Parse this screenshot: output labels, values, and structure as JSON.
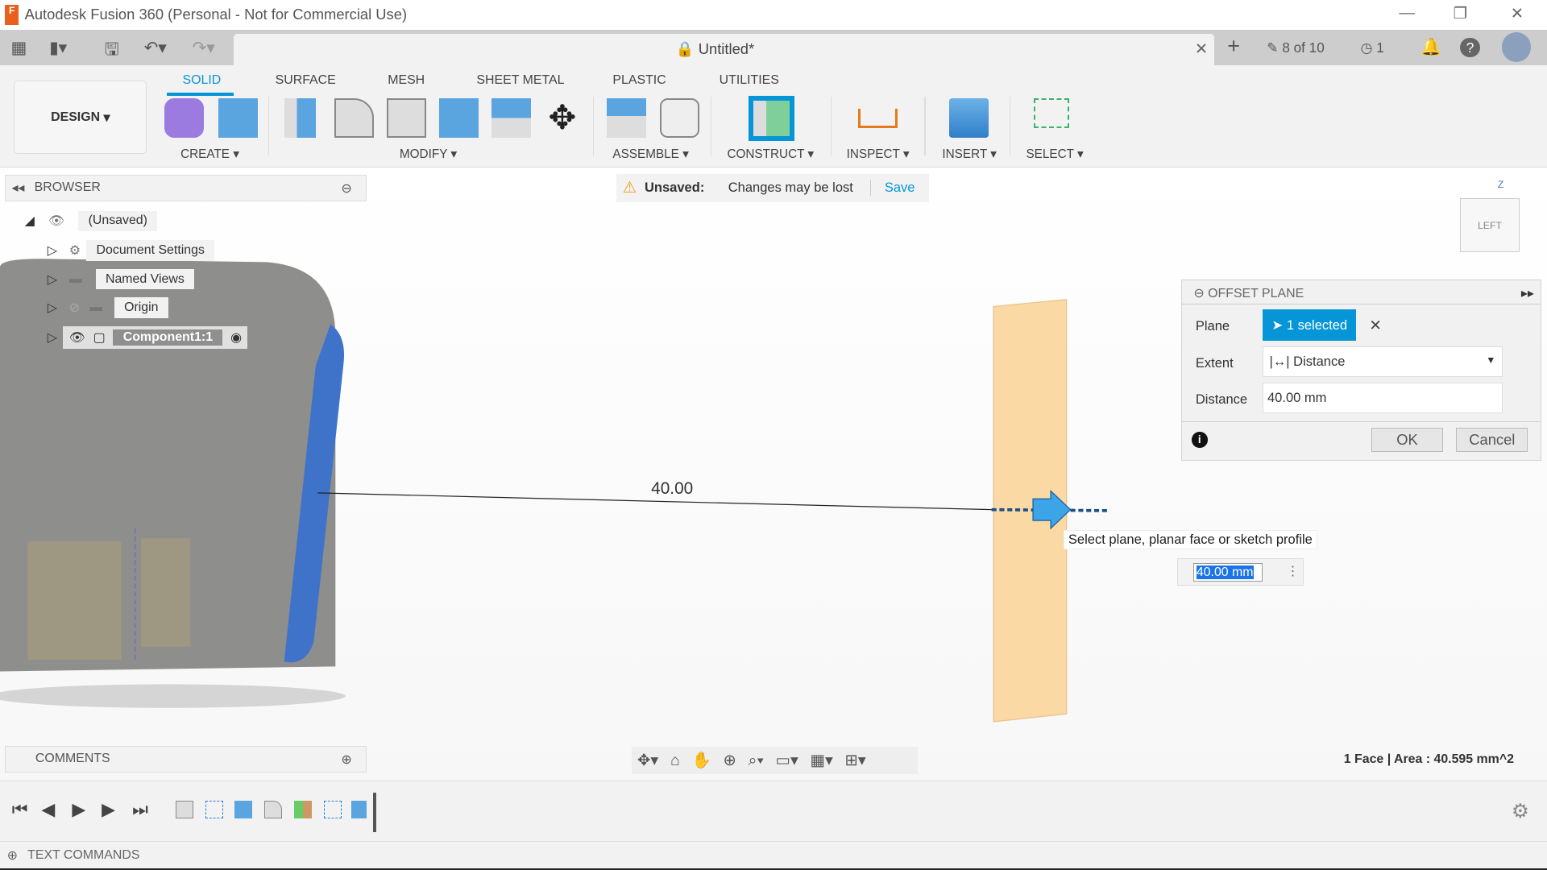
{
  "window": {
    "title": "Autodesk Fusion 360 (Personal - Not for Commercial Use)",
    "logo_letter": "F"
  },
  "quickbar": {
    "doc_title": "Untitled*",
    "jobs": "8 of 10",
    "history_count": "1"
  },
  "ribbon": {
    "workspace": "DESIGN",
    "tabs": [
      {
        "label": "SOLID",
        "active": true
      },
      {
        "label": "SURFACE"
      },
      {
        "label": "MESH"
      },
      {
        "label": "SHEET METAL"
      },
      {
        "label": "PLASTIC"
      },
      {
        "label": "UTILITIES"
      }
    ],
    "groups": [
      "CREATE",
      "MODIFY",
      "ASSEMBLE",
      "CONSTRUCT",
      "INSPECT",
      "INSERT",
      "SELECT"
    ],
    "accent": "#0696d7"
  },
  "browser": {
    "title": "BROWSER",
    "items": [
      {
        "label": "(Unsaved)"
      },
      {
        "label": "Document Settings"
      },
      {
        "label": "Named Views"
      },
      {
        "label": "Origin"
      },
      {
        "label": "Component1:1"
      }
    ]
  },
  "warning": {
    "label": "Unsaved:",
    "message": "Changes may be lost",
    "action": "Save"
  },
  "viewcube": {
    "face": "LEFT",
    "axis": "Z"
  },
  "dialog": {
    "title": "OFFSET PLANE",
    "plane_label": "Plane",
    "plane_value": "1 selected",
    "extent_label": "Extent",
    "extent_value": "Distance",
    "distance_label": "Distance",
    "distance_value": "40.00 mm",
    "ok": "OK",
    "cancel": "Cancel"
  },
  "canvas": {
    "dimension_text": "40.00",
    "tooltip": "Select plane, planar face or sketch profile",
    "input_value": "40.00 mm"
  },
  "comments": {
    "title": "COMMENTS"
  },
  "status": {
    "selection": "1 Face | Area : 40.595 mm^2"
  },
  "textcommands": {
    "title": "TEXT COMMANDS"
  }
}
